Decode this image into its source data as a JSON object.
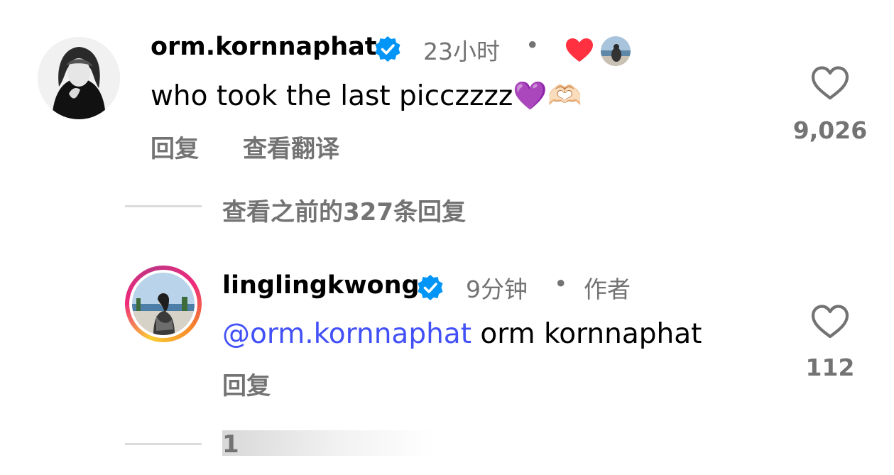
{
  "comments": [
    {
      "username": "orm.kornnaphat",
      "time": "23小时",
      "dot": "•",
      "text": "who took the last picczzzz",
      "emoji_1": "💜",
      "emoji_2": "🫶🏻",
      "reply_label": "回复",
      "translate_label": "查看翻译",
      "like_count": "9,026",
      "liked_by_icons": [
        "red-heart-icon",
        "liker-avatar"
      ]
    },
    {
      "username": "linglingkwong",
      "time": "9分钟",
      "dot": "•",
      "author_label": "作者",
      "mention": "@orm.kornnaphat",
      "text": " orm kornnaphat",
      "reply_label": "回复",
      "like_count": "112"
    }
  ],
  "view_previous_replies": "查看之前的327条回复",
  "bottom_partial_text": "1",
  "colors": {
    "secondary_text": "#737373",
    "mention_blue": "#4150f7",
    "verified_blue": "#0095f6",
    "heart_red": "#ff3040",
    "divider": "#dbdbdb"
  }
}
